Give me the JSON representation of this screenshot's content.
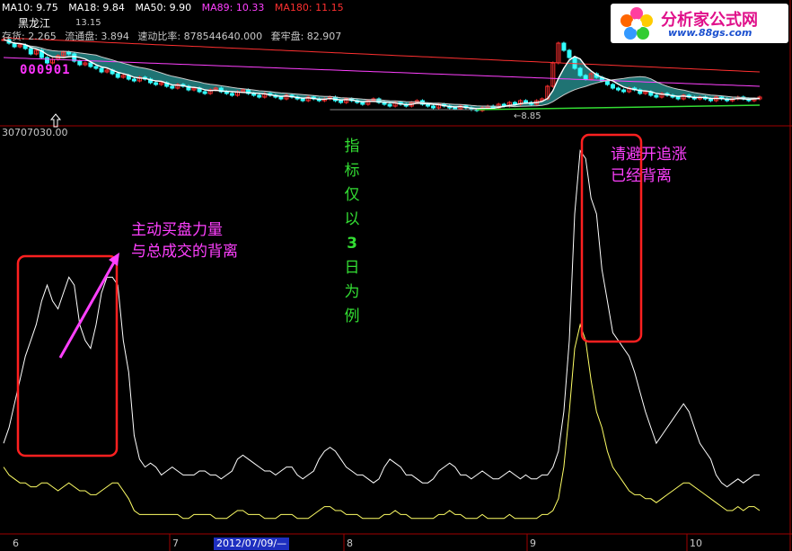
{
  "header": {
    "ma_labels": [
      {
        "text": "MA10: 9.75",
        "color": "#ffffff"
      },
      {
        "text": "MA18: 9.84",
        "color": "#ffffff"
      },
      {
        "text": "MA50: 9.90",
        "color": "#ffffff"
      },
      {
        "text": "MA89: 10.33",
        "color": "#ff40ff"
      },
      {
        "text": "MA180: 11.15",
        "color": "#ff3030"
      }
    ],
    "stock_name": "黑龙江",
    "line2": [
      "存货: 2.265",
      "流通盘: 3.894",
      "速动比率: 878544640.000",
      "套牢盘: 82.907"
    ],
    "stock_code": "000901",
    "high_label": "13.15",
    "low_label": "8.85",
    "volume_value": "30707030.00"
  },
  "watermark": {
    "title": "分析家公式网",
    "url": "www.88gs.com"
  },
  "annotations": {
    "left": [
      "主动买盘力量",
      "与总成交的背离"
    ],
    "right": [
      "请避开追涨",
      "已经背离"
    ],
    "vertical": [
      "指",
      "标",
      "仅",
      "以",
      "3",
      "日",
      "为",
      "例"
    ]
  },
  "x_axis": {
    "months": [
      "6",
      "7",
      "8",
      "9",
      "10"
    ],
    "cursor_date": "2012/07/09/—"
  },
  "colors": {
    "background": "#000000",
    "up_candle": "#ff3030",
    "down_candle": "#33ffff",
    "ma_short": "#ffffff",
    "ma89": "#ff40ff",
    "ma180": "#ff3030",
    "support": "#33dd33",
    "ribbon": "#2a9a9a",
    "indicator_main": "#ffffff",
    "indicator_sub": "#ffff66",
    "highlight_box": "#ff2020",
    "annotation_left": "#ff40ff",
    "annotation_vertical": "#33dd33"
  },
  "chart_data": [
    {
      "type": "line",
      "title": "",
      "xlabel": "",
      "ylabel": "",
      "x": [
        0,
        1,
        2,
        3,
        4,
        5,
        6,
        7,
        8,
        9,
        10,
        11,
        12,
        13,
        14,
        15,
        16,
        17,
        18,
        19,
        20,
        21,
        22,
        23,
        24,
        25,
        26,
        27,
        28,
        29,
        30,
        31,
        32,
        33,
        34,
        35,
        36,
        37,
        38,
        39,
        40,
        41,
        42,
        43,
        44,
        45,
        46,
        47,
        48,
        49,
        50,
        51,
        52,
        53,
        54,
        55,
        56,
        57,
        58,
        59,
        60,
        61,
        62,
        63,
        64,
        65,
        66,
        67,
        68,
        69,
        70,
        71,
        72,
        73,
        74,
        75,
        76,
        77,
        78,
        79,
        80,
        81,
        82,
        83,
        84,
        85,
        86,
        87,
        88,
        89,
        90,
        91,
        92,
        93,
        94,
        95,
        96,
        97,
        98,
        99,
        100,
        101,
        102,
        103,
        104,
        105,
        106,
        107,
        108,
        109,
        110,
        111,
        112,
        113,
        114,
        115,
        116,
        117,
        118,
        119,
        120,
        121,
        122,
        123,
        124,
        125,
        126,
        127,
        128,
        129,
        130,
        131,
        132,
        133,
        134,
        135,
        136,
        137,
        138,
        139
      ],
      "series": [
        {
          "values": [
            12.8,
            12.6,
            12.4,
            12.5,
            12.3,
            12.0,
            12.2,
            11.8,
            11.5,
            11.7,
            11.9,
            12.1,
            12.0,
            11.6,
            11.4,
            11.5,
            11.3,
            11.2,
            11.0,
            11.1,
            10.9,
            10.7,
            10.8,
            10.6,
            10.5,
            10.7,
            10.6,
            10.4,
            10.3,
            10.4,
            10.2,
            10.1,
            10.3,
            10.2,
            10.0,
            10.1,
            9.9,
            9.8,
            10.0,
            10.1,
            9.9,
            9.8,
            9.7,
            9.9,
            10.0,
            9.8,
            9.7,
            9.6,
            9.8,
            9.7,
            9.6,
            9.5,
            9.7,
            9.6,
            9.5,
            9.4,
            9.6,
            9.5,
            9.4,
            9.5,
            9.6,
            9.4,
            9.3,
            9.5,
            9.4,
            9.3,
            9.2,
            9.4,
            9.5,
            9.3,
            9.2,
            9.1,
            9.3,
            9.2,
            9.1,
            9.3,
            9.4,
            9.2,
            9.1,
            9.0,
            9.2,
            9.1,
            9.0,
            8.95,
            9.1,
            9.0,
            8.9,
            8.85,
            9.0,
            9.1,
            9.0,
            9.2,
            9.1,
            9.3,
            9.2,
            9.4,
            9.3,
            9.2,
            9.4,
            9.5,
            10.2,
            11.5,
            12.6,
            12.2,
            11.8,
            11.2,
            10.8,
            10.6,
            10.9,
            10.7,
            10.5,
            10.3,
            10.1,
            10.0,
            9.9,
            10.1,
            10.0,
            9.8,
            9.9,
            9.7,
            9.6,
            9.8,
            9.7,
            9.6,
            9.5,
            9.7,
            9.6,
            9.5,
            9.6,
            9.5,
            9.4,
            9.6,
            9.5,
            9.4,
            9.5,
            9.6,
            9.5,
            9.4,
            9.5,
            9.6
          ]
        }
      ]
    },
    {
      "type": "line",
      "title": "",
      "xlabel": "",
      "ylabel": "",
      "ylim": [
        0,
        100
      ],
      "x": [
        0,
        1,
        2,
        3,
        4,
        5,
        6,
        7,
        8,
        9,
        10,
        11,
        12,
        13,
        14,
        15,
        16,
        17,
        18,
        19,
        20,
        21,
        22,
        23,
        24,
        25,
        26,
        27,
        28,
        29,
        30,
        31,
        32,
        33,
        34,
        35,
        36,
        37,
        38,
        39,
        40,
        41,
        42,
        43,
        44,
        45,
        46,
        47,
        48,
        49,
        50,
        51,
        52,
        53,
        54,
        55,
        56,
        57,
        58,
        59,
        60,
        61,
        62,
        63,
        64,
        65,
        66,
        67,
        68,
        69,
        70,
        71,
        72,
        73,
        74,
        75,
        76,
        77,
        78,
        79,
        80,
        81,
        82,
        83,
        84,
        85,
        86,
        87,
        88,
        89,
        90,
        91,
        92,
        93,
        94,
        95,
        96,
        97,
        98,
        99,
        100,
        101,
        102,
        103,
        104,
        105,
        106,
        107,
        108,
        109,
        110,
        111,
        112,
        113,
        114,
        115,
        116,
        117,
        118,
        119,
        120,
        121,
        122,
        123,
        124,
        125,
        126,
        127,
        128,
        129,
        130,
        131,
        132,
        133,
        134,
        135,
        136,
        137,
        138,
        139
      ],
      "series": [
        {
          "values": [
            22,
            26,
            32,
            38,
            44,
            48,
            52,
            58,
            62,
            58,
            56,
            60,
            64,
            62,
            52,
            48,
            46,
            52,
            60,
            64,
            64,
            62,
            48,
            40,
            24,
            18,
            16,
            17,
            16,
            14,
            15,
            16,
            15,
            14,
            14,
            14,
            15,
            15,
            14,
            14,
            13,
            14,
            15,
            18,
            19,
            18,
            17,
            16,
            15,
            15,
            14,
            15,
            16,
            16,
            14,
            13,
            14,
            15,
            18,
            20,
            21,
            20,
            18,
            16,
            15,
            14,
            14,
            13,
            12,
            13,
            16,
            18,
            17,
            16,
            14,
            14,
            13,
            12,
            12,
            13,
            15,
            16,
            17,
            16,
            14,
            14,
            13,
            14,
            15,
            14,
            13,
            13,
            14,
            15,
            14,
            13,
            14,
            13,
            13,
            14,
            14,
            16,
            20,
            30,
            48,
            80,
            96,
            94,
            84,
            80,
            66,
            58,
            50,
            48,
            46,
            44,
            40,
            35,
            30,
            26,
            22,
            24,
            26,
            28,
            30,
            32,
            30,
            26,
            22,
            20,
            18,
            14,
            12,
            11,
            12,
            13,
            12,
            13,
            14,
            14
          ]
        },
        {
          "values": [
            16,
            14,
            13,
            12,
            12,
            11,
            11,
            12,
            12,
            11,
            10,
            11,
            12,
            11,
            10,
            10,
            9,
            9,
            10,
            11,
            12,
            12,
            10,
            8,
            5,
            4,
            4,
            4,
            4,
            4,
            4,
            4,
            4,
            3,
            3,
            4,
            4,
            4,
            4,
            3,
            3,
            3,
            4,
            5,
            5,
            4,
            4,
            4,
            3,
            3,
            3,
            4,
            4,
            4,
            3,
            3,
            3,
            4,
            5,
            6,
            6,
            5,
            5,
            4,
            4,
            4,
            3,
            3,
            3,
            3,
            4,
            4,
            5,
            4,
            4,
            3,
            3,
            3,
            3,
            3,
            4,
            4,
            5,
            4,
            4,
            3,
            3,
            3,
            4,
            3,
            3,
            3,
            3,
            4,
            3,
            3,
            3,
            3,
            3,
            4,
            4,
            5,
            8,
            16,
            30,
            46,
            52,
            48,
            38,
            30,
            26,
            20,
            16,
            14,
            12,
            10,
            9,
            9,
            8,
            8,
            7,
            8,
            9,
            10,
            11,
            12,
            12,
            11,
            10,
            9,
            8,
            7,
            6,
            5,
            5,
            6,
            5,
            6,
            6,
            5
          ]
        }
      ]
    }
  ]
}
